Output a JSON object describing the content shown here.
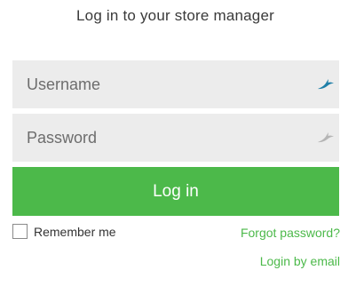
{
  "page": {
    "title": "Log in to your store manager"
  },
  "form": {
    "username_placeholder": "Username",
    "username_value": "",
    "password_placeholder": "Password",
    "password_value": "",
    "login_label": "Log in",
    "remember_label": "Remember me",
    "remember_checked": false,
    "forgot_label": "Forgot password?",
    "email_login_label": "Login by email"
  },
  "icons": {
    "username_icon": "bird-icon",
    "password_icon": "bird-icon"
  },
  "colors": {
    "accent": "#4cb94a",
    "field_bg": "#ececec",
    "username_icon": "#1e7fa8",
    "password_icon": "#b5b5b5"
  }
}
